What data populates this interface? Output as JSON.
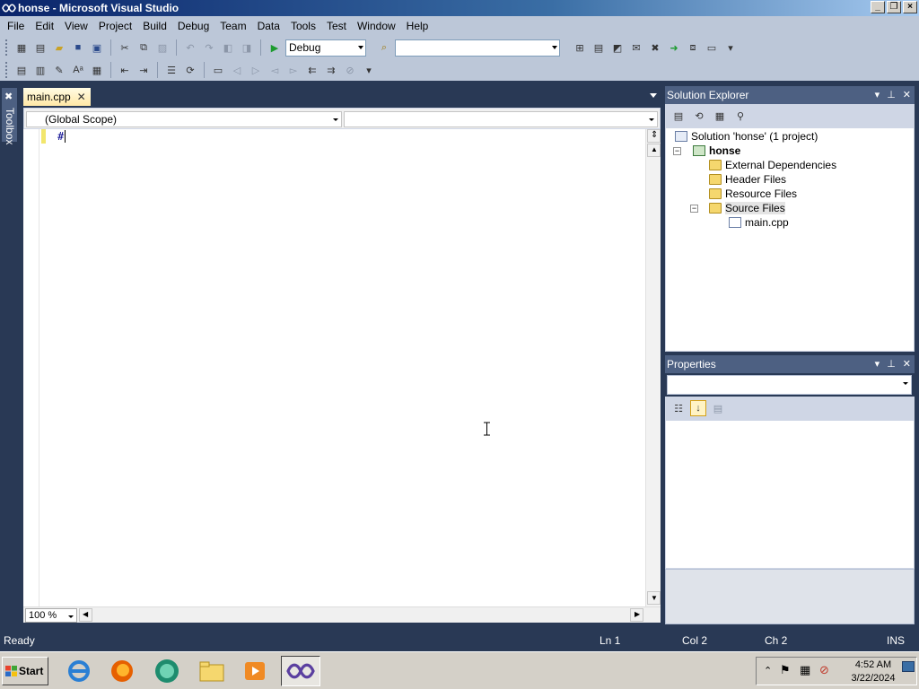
{
  "window": {
    "title": "honse - Microsoft Visual Studio"
  },
  "menu": [
    "File",
    "Edit",
    "View",
    "Project",
    "Build",
    "Debug",
    "Team",
    "Data",
    "Tools",
    "Test",
    "Window",
    "Help"
  ],
  "toolbar": {
    "config": "Debug",
    "platform": ""
  },
  "toolbox": {
    "label": "Toolbox"
  },
  "editor": {
    "tab_label": "main.cpp",
    "scope": "(Global Scope)",
    "member": "",
    "code": "#",
    "zoom": "100 %"
  },
  "solution_explorer": {
    "title": "Solution Explorer",
    "solution": "Solution 'honse' (1 project)",
    "project": "honse",
    "items": [
      "External Dependencies",
      "Header Files",
      "Resource Files",
      "Source Files"
    ],
    "source_file": "main.cpp"
  },
  "properties": {
    "title": "Properties"
  },
  "status": {
    "text": "Ready",
    "line": "Ln 1",
    "col": "Col 2",
    "ch": "Ch 2",
    "mode": "INS"
  },
  "taskbar": {
    "start": "Start",
    "time": "4:52 AM",
    "date": "3/22/2024"
  },
  "colors": {
    "chrome": "#293955",
    "panel_head": "#4d6082",
    "menubar": "#bcc7d8",
    "tab_active": "#ffe8a6"
  }
}
